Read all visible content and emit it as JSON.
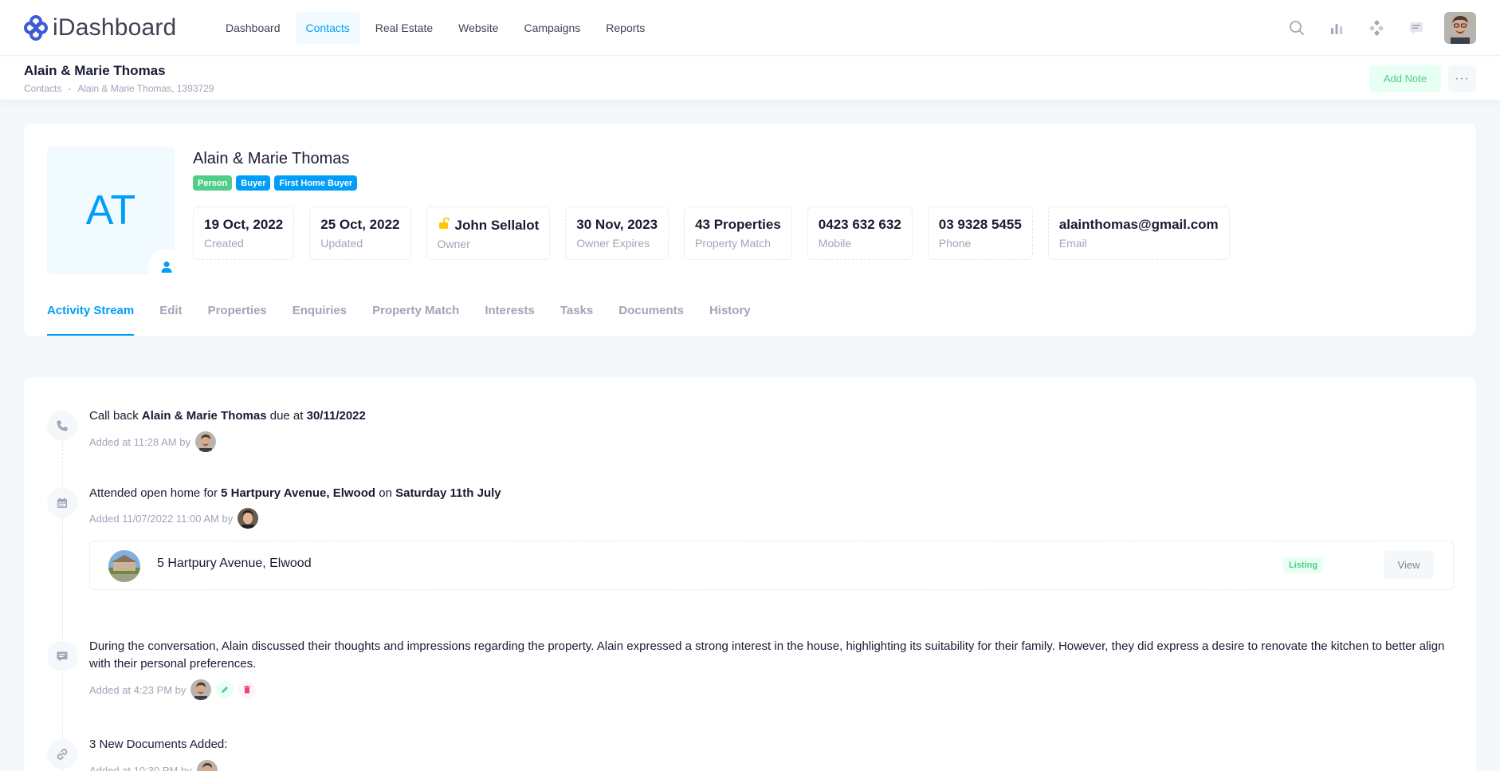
{
  "brand": {
    "name": "iDashboard",
    "color": "#3e5bd6"
  },
  "nav": {
    "items": [
      {
        "label": "Dashboard",
        "active": false
      },
      {
        "label": "Contacts",
        "active": true
      },
      {
        "label": "Real Estate",
        "active": false
      },
      {
        "label": "Website",
        "active": false
      },
      {
        "label": "Campaigns",
        "active": false
      },
      {
        "label": "Reports",
        "active": false
      }
    ],
    "icons": [
      "search-icon",
      "chart-icon",
      "apps-icon",
      "chat-icon"
    ]
  },
  "toolbar": {
    "title": "Alain & Marie Thomas",
    "breadcrumb": [
      "Contacts",
      "-",
      "Alain & Marie Thomas, 1393729"
    ],
    "add_note_label": "Add Note",
    "more_label": "···"
  },
  "profile": {
    "initials": "AT",
    "name": "Alain & Marie Thomas",
    "tags": [
      {
        "label": "Person",
        "color": "#50cd89"
      },
      {
        "label": "Buyer",
        "color": "#009ef7"
      },
      {
        "label": "First Home Buyer",
        "color": "#009ef7"
      }
    ],
    "stats": [
      {
        "value": "19 Oct, 2022",
        "label": "Created"
      },
      {
        "value": "25 Oct, 2022",
        "label": "Updated"
      },
      {
        "value": "John Sellalot",
        "label": "Owner",
        "icon": "unlock-icon"
      },
      {
        "value": "30 Nov, 2023",
        "label": "Owner Expires"
      },
      {
        "value": "43 Properties",
        "label": "Property Match"
      },
      {
        "value": "0423 632 632",
        "label": "Mobile"
      },
      {
        "value": "03 9328 5455",
        "label": "Phone"
      },
      {
        "value": "alainthomas@gmail.com",
        "label": "Email"
      }
    ],
    "tabs": [
      "Activity Stream",
      "Edit",
      "Properties",
      "Enquiries",
      "Property Match",
      "Interests",
      "Tasks",
      "Documents",
      "History"
    ],
    "active_tab": "Activity Stream"
  },
  "activity": {
    "items": [
      {
        "icon": "phone-icon",
        "text_parts": [
          "Call back ",
          "Alain & Marie Thomas",
          " due at ",
          "30/11/2022"
        ],
        "meta": "Added at 11:28 AM by"
      },
      {
        "icon": "calendar-icon",
        "text_parts": [
          "Attended open home for ",
          "5 Hartpury Avenue, Elwood",
          " on ",
          "Saturday 11th July"
        ],
        "meta": "Added 11/07/2022 11:00 AM by",
        "property": {
          "name": "5 Hartpury Avenue, Elwood",
          "badge": "Listing",
          "button": "View"
        }
      },
      {
        "icon": "message-icon",
        "text": "During the conversation, Alain discussed their thoughts and impressions regarding the property. Alain expressed a strong interest in the house, highlighting its suitability for their family. However, they did express a desire to renovate the kitchen to better align with their personal preferences.",
        "meta": "Added at 4:23 PM by"
      },
      {
        "icon": "link-icon",
        "text": "3 New Documents Added:",
        "meta": "Added at 10:30 PM by"
      }
    ]
  }
}
